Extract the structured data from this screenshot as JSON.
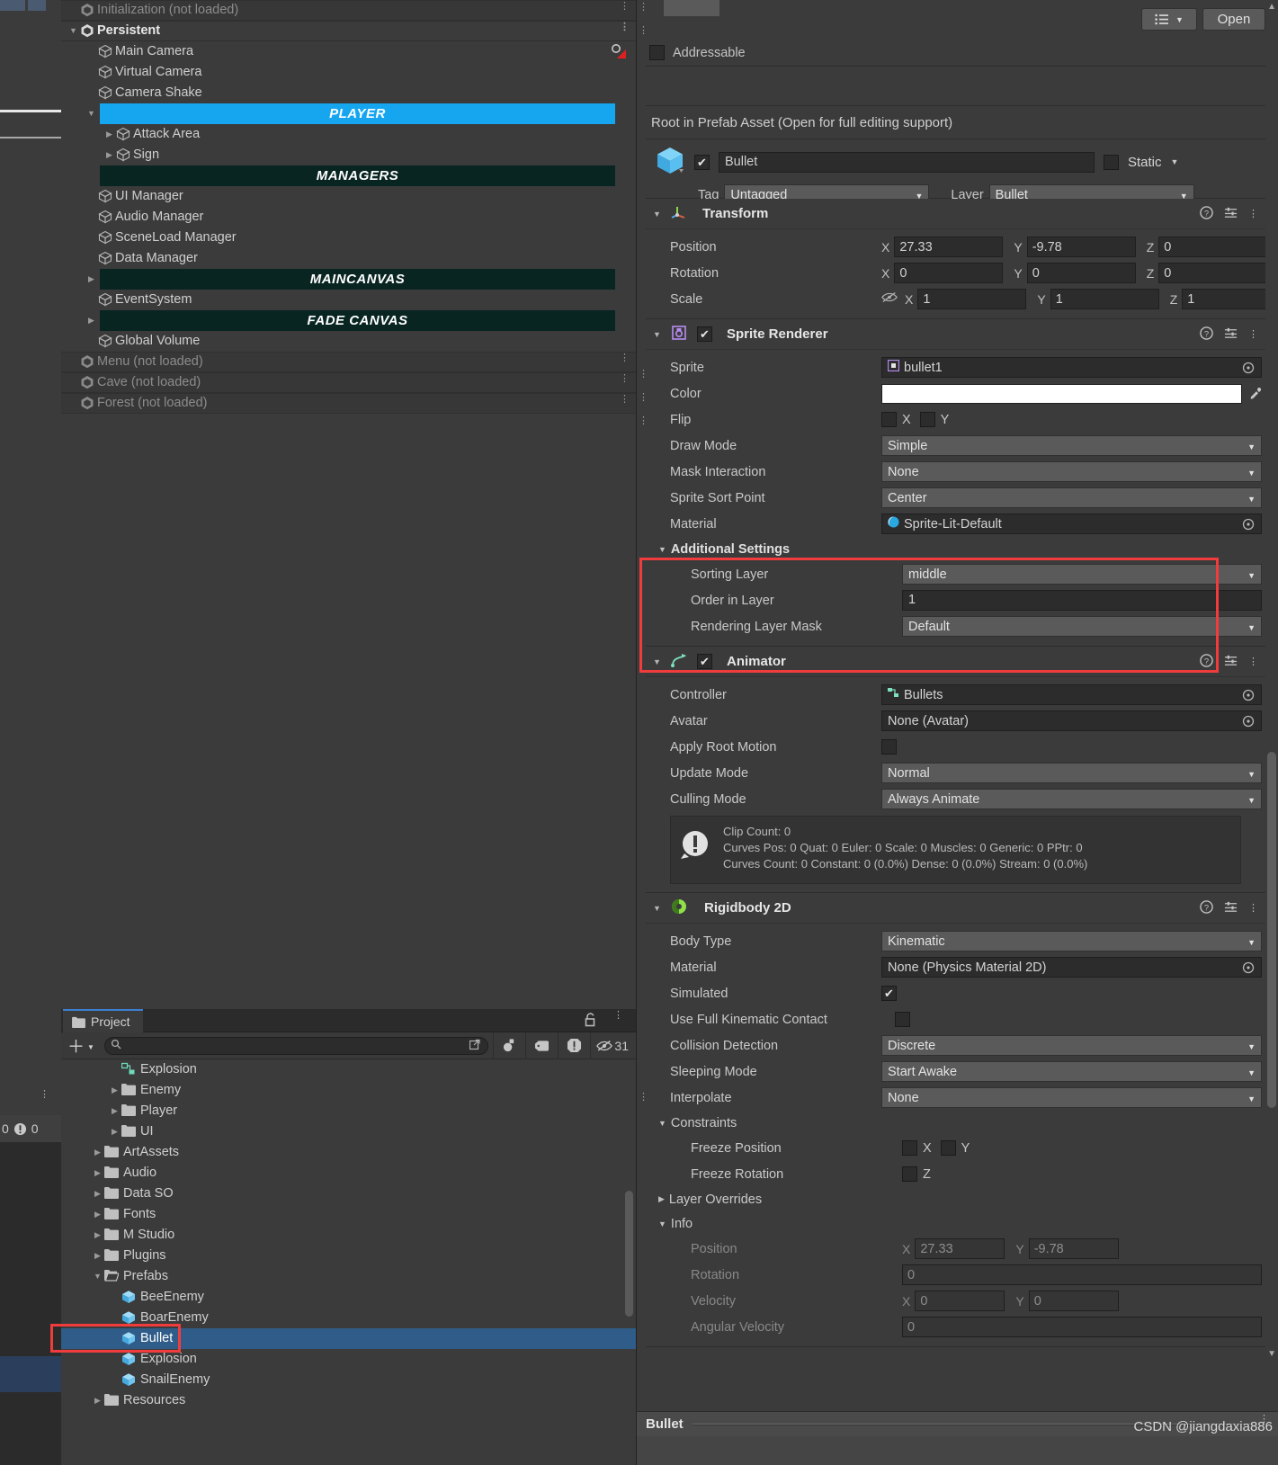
{
  "hierarchy": {
    "rows": [
      {
        "label": "Initialization (not loaded)",
        "type": "scene",
        "dim": true,
        "indent": 0,
        "fold": "",
        "dots": true
      },
      {
        "label": "Persistent",
        "type": "sceneLoaded",
        "dim": false,
        "indent": 0,
        "fold": "down",
        "dots": true
      },
      {
        "label": "Main Camera",
        "type": "go",
        "indent": 1,
        "fold": "",
        "flag": true
      },
      {
        "label": "Virtual Camera",
        "type": "go",
        "indent": 1,
        "fold": ""
      },
      {
        "label": "Camera Shake",
        "type": "go",
        "indent": 1,
        "fold": ""
      },
      {
        "label": "PLAYER",
        "type": "banner-player",
        "indent": 1,
        "fold": "down"
      },
      {
        "label": "Attack Area",
        "type": "go",
        "indent": 2,
        "fold": "right"
      },
      {
        "label": "Sign",
        "type": "go",
        "indent": 2,
        "fold": "right"
      },
      {
        "label": "MANAGERS",
        "type": "banner-dark",
        "indent": 1,
        "fold": ""
      },
      {
        "label": "UI Manager",
        "type": "go",
        "indent": 1,
        "fold": ""
      },
      {
        "label": "Audio Manager",
        "type": "go",
        "indent": 1,
        "fold": ""
      },
      {
        "label": "SceneLoad Manager",
        "type": "go",
        "indent": 1,
        "fold": ""
      },
      {
        "label": "Data Manager",
        "type": "go",
        "indent": 1,
        "fold": ""
      },
      {
        "label": "MAINCANVAS",
        "type": "banner-dark",
        "indent": 1,
        "fold": "right"
      },
      {
        "label": "EventSystem",
        "type": "go",
        "indent": 1,
        "fold": ""
      },
      {
        "label": "FADE CANVAS",
        "type": "banner-dark",
        "indent": 1,
        "fold": "right"
      },
      {
        "label": "Global Volume",
        "type": "go",
        "indent": 1,
        "fold": ""
      },
      {
        "label": "Menu (not loaded)",
        "type": "scene",
        "dim": true,
        "indent": 0,
        "fold": "",
        "dots": true
      },
      {
        "label": "Cave (not loaded)",
        "type": "scene",
        "dim": true,
        "indent": 0,
        "fold": "",
        "dots": true
      },
      {
        "label": "Forest (not loaded)",
        "type": "scene",
        "dim": true,
        "indent": 0,
        "fold": "",
        "dots": true
      }
    ]
  },
  "project": {
    "tab_label": "Project",
    "search_placeholder": "",
    "search_value": "",
    "hidden_count": "31",
    "rows": [
      {
        "label": "Explosion",
        "kind": "anim",
        "indent": 2,
        "fold": "",
        "sel": false
      },
      {
        "label": "Enemy",
        "kind": "folder",
        "indent": 2,
        "fold": "right",
        "sel": false
      },
      {
        "label": "Player",
        "kind": "folder",
        "indent": 2,
        "fold": "right",
        "sel": false
      },
      {
        "label": "UI",
        "kind": "folder",
        "indent": 2,
        "fold": "right",
        "sel": false
      },
      {
        "label": "ArtAssets",
        "kind": "folder",
        "indent": 1,
        "fold": "right",
        "sel": false
      },
      {
        "label": "Audio",
        "kind": "folder",
        "indent": 1,
        "fold": "right",
        "sel": false
      },
      {
        "label": "Data SO",
        "kind": "folder",
        "indent": 1,
        "fold": "right",
        "sel": false
      },
      {
        "label": "Fonts",
        "kind": "folder",
        "indent": 1,
        "fold": "right",
        "sel": false
      },
      {
        "label": "M Studio",
        "kind": "folder",
        "indent": 1,
        "fold": "right",
        "sel": false
      },
      {
        "label": "Plugins",
        "kind": "folder",
        "indent": 1,
        "fold": "right",
        "sel": false
      },
      {
        "label": "Prefabs",
        "kind": "folder-open",
        "indent": 1,
        "fold": "down",
        "sel": false
      },
      {
        "label": "BeeEnemy",
        "kind": "prefab",
        "indent": 2,
        "fold": "",
        "sel": false
      },
      {
        "label": "BoarEnemy",
        "kind": "prefab",
        "indent": 2,
        "fold": "",
        "sel": false
      },
      {
        "label": "Bullet",
        "kind": "prefab",
        "indent": 2,
        "fold": "",
        "sel": true
      },
      {
        "label": "Explosion",
        "kind": "prefab",
        "indent": 2,
        "fold": "",
        "sel": false
      },
      {
        "label": "SnailEnemy",
        "kind": "prefab",
        "indent": 2,
        "fold": "",
        "sel": false
      },
      {
        "label": "Resources",
        "kind": "folder",
        "indent": 1,
        "fold": "right",
        "sel": false
      }
    ]
  },
  "inspector": {
    "open_button": "Open",
    "addressable_label": "Addressable",
    "addressable_checked": false,
    "prefab_note": "Root in Prefab Asset (Open for full editing support)",
    "object_name": "Bullet",
    "object_enabled": true,
    "static_label": "Static",
    "static_checked": false,
    "tag_label": "Tag",
    "tag_value": "Untagged",
    "layer_label": "Layer",
    "layer_value": "Bullet",
    "transform": {
      "title": "Transform",
      "position_label": "Position",
      "position": {
        "x": "27.33",
        "y": "-9.78",
        "z": "0"
      },
      "rotation_label": "Rotation",
      "rotation": {
        "x": "0",
        "y": "0",
        "z": "0"
      },
      "scale_label": "Scale",
      "scale": {
        "x": "1",
        "y": "1",
        "z": "1"
      }
    },
    "sprite_renderer": {
      "title": "Sprite Renderer",
      "enabled": true,
      "sprite_label": "Sprite",
      "sprite_value": "bullet1",
      "color_label": "Color",
      "color_value": "#FFFFFF",
      "flip_label": "Flip",
      "flip_x_label": "X",
      "flip_y_label": "Y",
      "flip_x": false,
      "flip_y": false,
      "draw_mode_label": "Draw Mode",
      "draw_mode_value": "Simple",
      "mask_interaction_label": "Mask Interaction",
      "mask_interaction_value": "None",
      "sort_point_label": "Sprite Sort Point",
      "sort_point_value": "Center",
      "material_label": "Material",
      "material_value": "Sprite-Lit-Default",
      "additional_settings_label": "Additional Settings",
      "sorting_layer_label": "Sorting Layer",
      "sorting_layer_value": "middle",
      "order_in_layer_label": "Order in Layer",
      "order_in_layer_value": "1",
      "rendering_layer_mask_label": "Rendering Layer Mask",
      "rendering_layer_mask_value": "Default"
    },
    "animator": {
      "title": "Animator",
      "enabled": true,
      "controller_label": "Controller",
      "controller_value": "Bullets",
      "avatar_label": "Avatar",
      "avatar_value": "None (Avatar)",
      "apply_root_motion_label": "Apply Root Motion",
      "apply_root_motion": false,
      "update_mode_label": "Update Mode",
      "update_mode_value": "Normal",
      "culling_mode_label": "Culling Mode",
      "culling_mode_value": "Always Animate",
      "info_line1": "Clip Count: 0",
      "info_line2": "Curves Pos: 0 Quat: 0 Euler: 0 Scale: 0 Muscles: 0 Generic: 0 PPtr: 0",
      "info_line3": "Curves Count: 0 Constant: 0 (0.0%) Dense: 0 (0.0%) Stream: 0 (0.0%)"
    },
    "rigidbody2d": {
      "title": "Rigidbody 2D",
      "body_type_label": "Body Type",
      "body_type_value": "Kinematic",
      "material_label": "Material",
      "material_value": "None (Physics Material 2D)",
      "simulated_label": "Simulated",
      "simulated": true,
      "use_full_kinematic_label": "Use Full Kinematic Contact",
      "use_full_kinematic": false,
      "collision_detection_label": "Collision Detection",
      "collision_detection_value": "Discrete",
      "sleeping_mode_label": "Sleeping Mode",
      "sleeping_mode_value": "Start Awake",
      "interpolate_label": "Interpolate",
      "interpolate_value": "None",
      "constraints_label": "Constraints",
      "freeze_position_label": "Freeze Position",
      "freeze_position_x_label": "X",
      "freeze_position_y_label": "Y",
      "freeze_rotation_label": "Freeze Rotation",
      "freeze_rotation_z_label": "Z",
      "layer_overrides_label": "Layer Overrides",
      "info_label": "Info",
      "info_position_label": "Position",
      "info_position": {
        "x": "27.33",
        "y": "-9.78"
      },
      "info_rotation_label": "Rotation",
      "info_rotation": "0",
      "info_velocity_label": "Velocity",
      "info_velocity": {
        "x": "0",
        "y": "0"
      },
      "info_angular_velocity_label": "Angular Velocity",
      "info_angular_velocity": "0"
    },
    "footer_name": "Bullet"
  },
  "watermark": "CSDN @jiangdaxia886",
  "colors": {
    "accent_blue": "#16a6f0",
    "selection_blue": "#2f5c88",
    "highlight_red": "#f03c3c",
    "banner_dark": "#082522"
  }
}
